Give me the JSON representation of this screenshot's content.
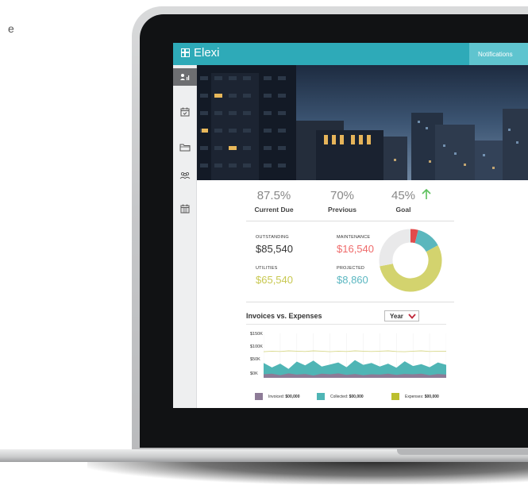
{
  "page": {
    "stray_text": "e"
  },
  "app": {
    "name": "Elexi",
    "notifications_label": "Notifications"
  },
  "sidebar": {
    "items": [
      {
        "icon": "person-chart-icon",
        "active": true
      },
      {
        "icon": "calendar-check-icon",
        "active": false
      },
      {
        "icon": "folder-icon",
        "active": false
      },
      {
        "icon": "people-icon",
        "active": false
      },
      {
        "icon": "calendar-grid-icon",
        "active": false
      }
    ]
  },
  "stats": [
    {
      "value": "87.5%",
      "label": "Current Due"
    },
    {
      "value": "70%",
      "label": "Previous"
    },
    {
      "value": "45%",
      "label": "Goal",
      "trend": "up"
    }
  ],
  "summary": {
    "outstanding": {
      "label": "OUTSTANDING",
      "value": "$85,540",
      "color": "#333333"
    },
    "maintenance": {
      "label": "MAINTENANCE",
      "value": "$16,540",
      "color": "#ef6b6b"
    },
    "utilities": {
      "label": "UTILITIES",
      "value": "$65,540",
      "color": "#c8c850"
    },
    "projected": {
      "label": "PROJECTED",
      "value": "$8,860",
      "color": "#5bb7c1"
    }
  },
  "donut": {
    "segments": [
      {
        "name": "maintenance",
        "value": 4,
        "color": "#e24b4b"
      },
      {
        "name": "projected",
        "value": 13,
        "color": "#5bb7bd"
      },
      {
        "name": "utilities",
        "value": 55,
        "color": "#d3d36e"
      },
      {
        "name": "outstanding",
        "value": 28,
        "color": "#e9e9ea"
      }
    ]
  },
  "chart": {
    "title": "Invoices vs. Expenses",
    "period": "Year",
    "yticks": [
      "$150K",
      "$100K",
      "$50K",
      "$0K"
    ],
    "legend": [
      {
        "name": "Invoiced:",
        "value": "$00,000",
        "color": "#8d7b97"
      },
      {
        "name": "Collected:",
        "value": "$00,000",
        "color": "#4fb5b5"
      },
      {
        "name": "Expenses:",
        "value": "$00,000",
        "color": "#bcbf2e"
      }
    ]
  },
  "chart_data": {
    "type": "area",
    "yticks": [
      "$150K",
      "$100K",
      "$50K",
      "$0K"
    ],
    "ylim": [
      0,
      150000
    ],
    "series": [
      {
        "name": "Invoiced:",
        "values": [
          12000,
          14000,
          9000,
          15000,
          11000,
          13000,
          8000,
          14000,
          12000,
          15000,
          10000,
          13000,
          9000,
          12000,
          11000,
          14000,
          10000,
          13000,
          12000,
          14000,
          9000,
          13000,
          11000
        ]
      },
      {
        "name": "Collected:",
        "values": [
          50000,
          35000,
          48000,
          30000,
          55000,
          42000,
          58000,
          38000,
          45000,
          52000,
          36000,
          60000,
          44000,
          50000,
          38000,
          48000,
          34000,
          56000,
          40000,
          46000,
          36000,
          52000,
          44000
        ]
      },
      {
        "name": "Expenses:",
        "values": [
          88000,
          90000,
          89000,
          91000,
          90000,
          89000,
          91000,
          90000,
          88000,
          90000,
          89000,
          91000,
          90000,
          89000,
          90000,
          91000,
          89000,
          88000,
          90000,
          91000,
          89000,
          90000,
          90000
        ]
      }
    ]
  }
}
